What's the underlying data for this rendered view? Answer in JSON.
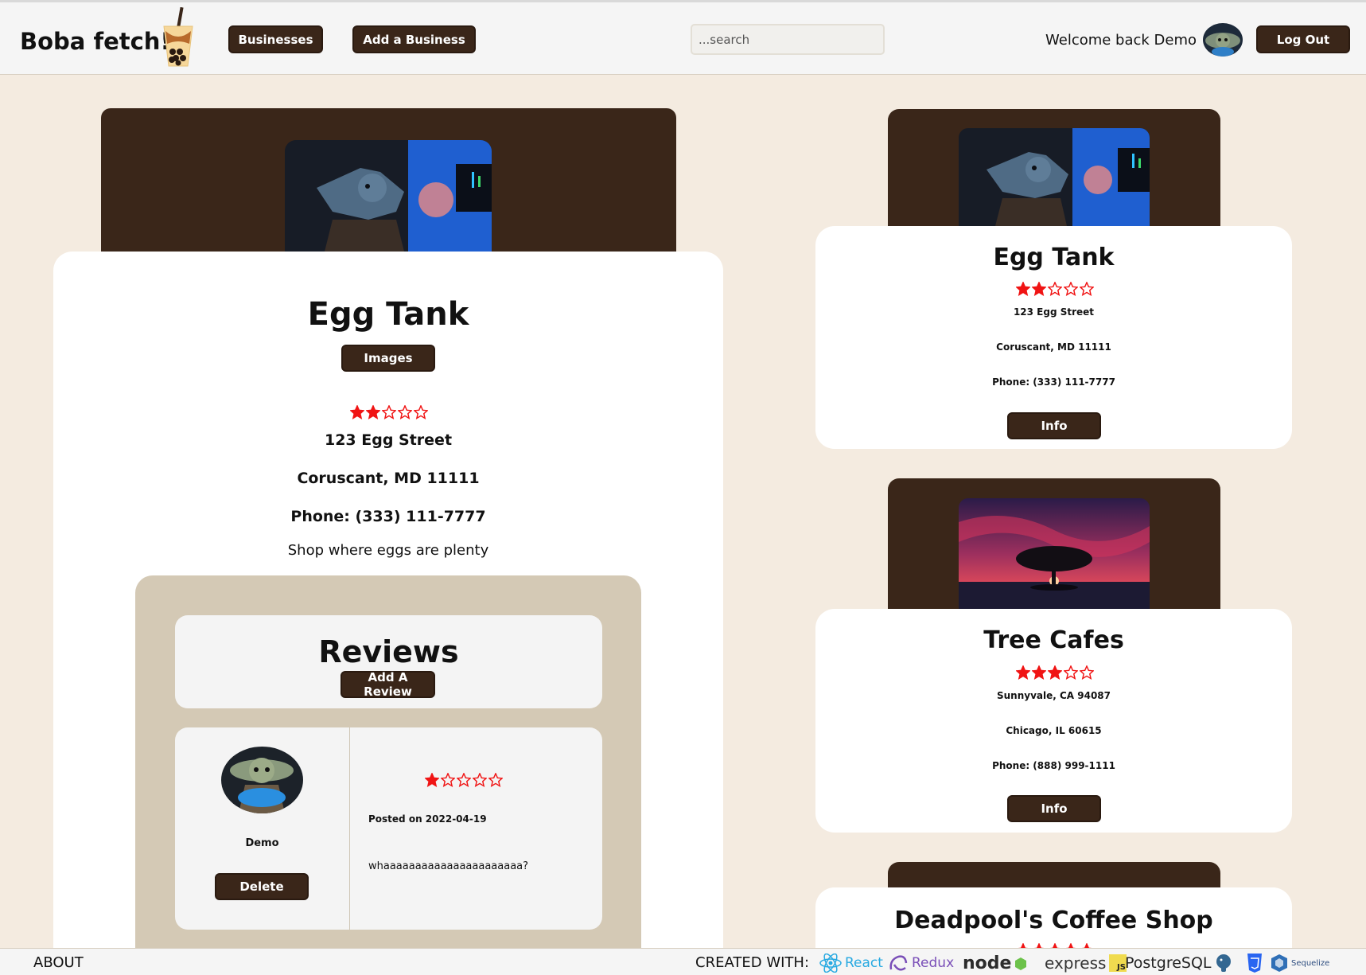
{
  "navbar": {
    "logo_text": "Boba fetch!",
    "businesses_label": "Businesses",
    "add_business_label": "Add a Business",
    "search_placeholder": "...search",
    "welcome_text": "Welcome back Demo",
    "logout_label": "Log Out"
  },
  "business": {
    "name": "Egg Tank",
    "images_label": "Images",
    "rating": 2,
    "address": "123 Egg Street",
    "city_line": "Coruscant, MD 11111",
    "phone_line": "Phone: (333) 111-7777",
    "description": "Shop where eggs are plenty"
  },
  "reviews": {
    "title": "Reviews",
    "add_label": "Add A Review",
    "items": [
      {
        "user": "Demo",
        "rating": 1,
        "posted": "Posted on 2022-04-19",
        "text": "whaaaaaaaaaaaaaaaaaaaaaa?",
        "delete_label": "Delete"
      }
    ]
  },
  "sidebar": {
    "cards": [
      {
        "name": "Egg Tank",
        "rating": 2,
        "line1": "123 Egg Street",
        "line2": "Coruscant, MD 11111",
        "line3": "Phone: (333) 111-7777",
        "info_label": "Info"
      },
      {
        "name": "Tree Cafes",
        "rating": 3,
        "line1": "Sunnyvale, CA 94087",
        "line2": "Chicago, IL 60615",
        "line3": "Phone: (888) 999-1111",
        "info_label": "Info"
      },
      {
        "name": "Deadpool's Coffee Shop",
        "rating": 5
      }
    ]
  },
  "footer": {
    "about_label": "ABOUT",
    "created_label": "CREATED WITH:",
    "tech": [
      "React",
      "Redux",
      "node",
      "express",
      "PostgreSQL",
      "Sequelize"
    ]
  },
  "colors": {
    "brand_dark": "#3a2619",
    "background": "#f4ebe0",
    "star_red": "#f01414",
    "reviews_panel": "#d4c9b5"
  },
  "icons": [
    "boba-cup-icon",
    "star-icon",
    "react-icon",
    "redux-icon",
    "node-icon",
    "express-icon",
    "js-icon",
    "postgresql-icon",
    "css3-icon",
    "sequelize-icon"
  ]
}
